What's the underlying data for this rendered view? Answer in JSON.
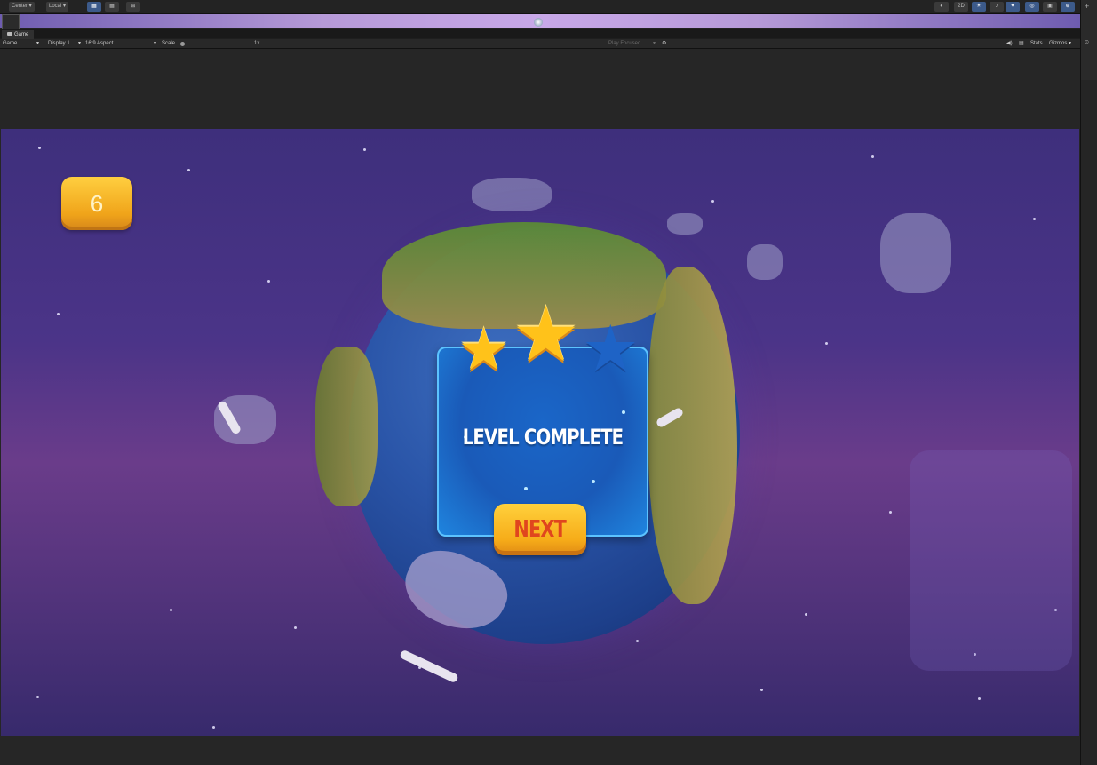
{
  "toolbar": {
    "pivot_mode": "Center",
    "pivot_rotation": "Local",
    "view_2d": "2D"
  },
  "game_tab": {
    "label": "Game"
  },
  "controls": {
    "view_dropdown": "Game",
    "display": "Display 1",
    "aspect": "16:9 Aspect",
    "scale_label": "Scale",
    "scale_value": "1x",
    "play_mode": "Play Focused",
    "stats": "Stats",
    "gizmos": "Gizmos"
  },
  "hud": {
    "score": "6"
  },
  "level_panel": {
    "title": "LEVEL COMPLETE",
    "next_label": "NEXT",
    "stars_earned": 2,
    "stars_total": 3
  },
  "colors": {
    "accent_gold": "#ffc21a",
    "panel_blue": "#1a5ab8",
    "next_text": "#e0461e",
    "sky_top": "#3e2f7c"
  },
  "icons": [
    "gear-icon",
    "speaker-icon",
    "stats-icon",
    "lock-icon",
    "plus-icon",
    "view-tool-icon"
  ]
}
